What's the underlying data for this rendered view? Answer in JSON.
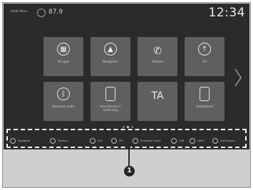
{
  "status": {
    "source": "Audio Menu",
    "frequency": "87.9",
    "clock": "12:34"
  },
  "tiles": [
    {
      "label": "HS apps",
      "icon": "apps-icon"
    },
    {
      "label": "Navigation",
      "icon": "navigation-icon"
    },
    {
      "label": "Telefoon",
      "icon": "phone-icon"
    },
    {
      "label": "FM",
      "icon": "fm-radio-icon"
    },
    {
      "label": "Bluetooth audio",
      "icon": "bluetooth-icon"
    },
    {
      "label": "Smartphone in verbinding",
      "icon": "smartphone-icon"
    },
    {
      "label": "TA",
      "icon": "ta-text"
    },
    {
      "label": "Info/bediend",
      "icon": "info-icon"
    }
  ],
  "pager": {
    "pages": 3,
    "current": 1
  },
  "shortcuts": [
    {
      "label": "Navigatie",
      "icon": "navigation-icon"
    },
    {
      "label": "Telefoon",
      "icon": "phone-icon"
    },
    {
      "label": "Info",
      "icon": "info-icon"
    },
    {
      "label": "FM",
      "icon": "fm-radio-icon"
    },
    {
      "label": "Bluetooth audio",
      "icon": "bluetooth-icon"
    },
    {
      "label": "USB",
      "icon": "usb-icon"
    },
    {
      "label": "HDMI",
      "icon": "hdmi-icon"
    },
    {
      "label": "Instellingen",
      "icon": "settings-icon"
    }
  ],
  "callout": {
    "number": "1"
  },
  "colors": {
    "screen_bg": "#2b2b2b",
    "tile_bg": "#5f5f5f",
    "highlight_box": "#ffffff",
    "callout_bg": "#262626"
  }
}
